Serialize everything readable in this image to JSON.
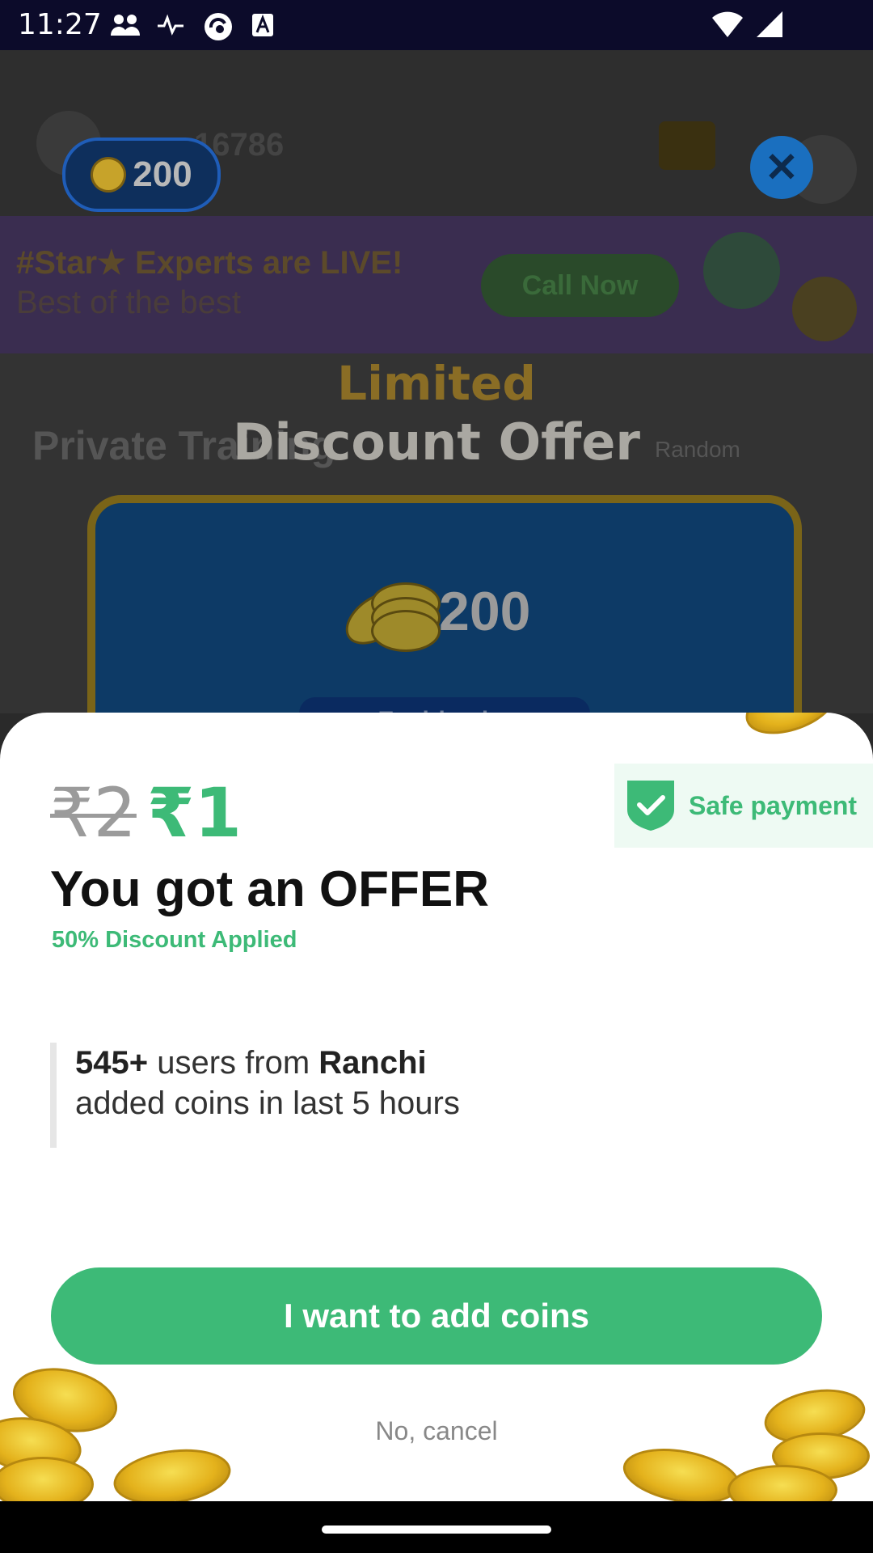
{
  "status_bar": {
    "time": "11:27"
  },
  "background_app": {
    "score": "16786",
    "banner_line1": "#Star★ Experts are LIVE!",
    "banner_line2": "Best of the best",
    "call_now_label": "Call Now",
    "section_title": "Private Training",
    "random_label": "Random"
  },
  "overlay": {
    "coin_balance": "200",
    "close_icon": "close-icon",
    "title_line1": "Limited",
    "title_line2": "Discount Offer",
    "card_coins": "200",
    "card_expiring": "Expiring in:"
  },
  "sheet": {
    "old_price": "₹2",
    "new_price": "₹1",
    "safe_payment_label": "Safe payment",
    "headline": "You got an OFFER",
    "discount_text": "50% Discount Applied",
    "social_count": "545+",
    "social_mid": " users from ",
    "social_city": "Ranchi",
    "social_line2": "added coins in last 5 hours",
    "cta_label": "I want to add coins",
    "cancel_label": "No, cancel"
  },
  "colors": {
    "accent": "#3dba77",
    "status_bar": "#0c0b2a"
  }
}
